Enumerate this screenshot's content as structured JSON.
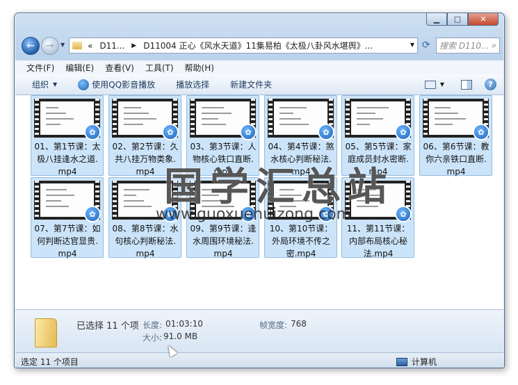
{
  "window": {
    "minimize": "▁",
    "maximize": "□",
    "close": "✕"
  },
  "nav": {
    "back": "←",
    "forward": "→",
    "breadcrumbs": [
      "«",
      "D11...",
      "D11004 正心《风水天道》11集易柏《太极八卦风水堪舆》..."
    ],
    "separator": "▶",
    "search_placeholder": "搜索 D110..."
  },
  "menu": [
    "文件(F)",
    "编辑(E)",
    "查看(V)",
    "工具(T)",
    "帮助(H)"
  ],
  "toolbar": {
    "organize": "组织",
    "play_qq": "使用QQ影音播放",
    "play_selection": "播放选择",
    "new_folder": "新建文件夹",
    "help": "?"
  },
  "files": [
    "01、第1节课：太极八挂逢水之道.mp4",
    "02、第2节课：久共八挂万物类象.mp4",
    "03、第3节课：人物核心铁口直断.mp4",
    "04、第4节课：煞水核心判断秘法.mp4",
    "05、第5节课：家庭成员封水密断.mp4",
    "06、第6节课：教你六亲铁口直断.mp4",
    "07、第7节课：如何判断达官显贵.mp4",
    "08、第8节课：水句核心判断秘法.mp4",
    "09、第9节课：逢水周围环境秘法.mp4",
    "10、第10节课：外局环境不传之密.mp4",
    "11、第11节课：内部布局核心秘法.mp4"
  ],
  "file_labels": [
    "01、第1节课：太\n极八挂逢水之道.\nmp4",
    "02、第2节课：久\n共八挂万物类象.\nmp4",
    "03、第3节课：人\n物核心铁口直断.\nmp4",
    "04、第4节课：煞\n水核心判断秘法.\nmp4",
    "05、第5节课：家\n庭成员封水密断.\nmp4",
    "06、第6节课：教\n你六亲铁口直断.\nmp4",
    "07、第7节课：如\n何判断达官显贵.\nmp4",
    "08、第8节课：水\n句核心判断秘法.\nmp4",
    "09、第9节课：逢\n水周围环境秘法.\nmp4",
    "10、第10节课：\n外局环境不传之\n密.mp4",
    "11、第11节课：\n内部布局核心秘\n法.mp4"
  ],
  "watermark": {
    "cn": "国学汇总站",
    "url": "www.guoxuehuizong.com"
  },
  "details": {
    "selected": "已选择 11 个项",
    "length_label": "长度:",
    "length": "01:03:10",
    "framewidth_label": "帧宽度:",
    "framewidth": "768",
    "size_label": "大小:",
    "size": "91.0 MB"
  },
  "status": {
    "left": "选定 11 个项目",
    "right": "计算机"
  },
  "colors": {
    "selection": "#cce4f9",
    "frame": "#4d6f94"
  }
}
